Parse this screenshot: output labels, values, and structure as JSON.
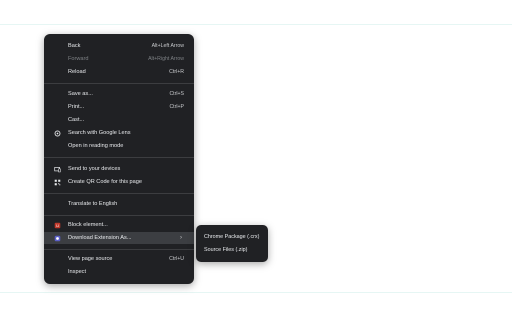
{
  "context_menu": {
    "items": {
      "back": {
        "label": "Back",
        "shortcut": "Alt+Left Arrow"
      },
      "forward": {
        "label": "Forward",
        "shortcut": "Alt+Right Arrow"
      },
      "reload": {
        "label": "Reload",
        "shortcut": "Ctrl+R"
      },
      "save_as": {
        "label": "Save as...",
        "shortcut": "Ctrl+S"
      },
      "print": {
        "label": "Print...",
        "shortcut": "Ctrl+P"
      },
      "cast": {
        "label": "Cast..."
      },
      "search_lens": {
        "label": "Search with Google Lens",
        "icon": "google-lens-icon"
      },
      "reading_mode": {
        "label": "Open in reading mode"
      },
      "send_devices": {
        "label": "Send to your devices",
        "icon": "devices-icon"
      },
      "qr_code": {
        "label": "Create QR Code for this page",
        "icon": "qr-code-icon"
      },
      "translate": {
        "label": "Translate to English"
      },
      "block_element": {
        "label": "Block element...",
        "icon": "adblock-icon"
      },
      "download_extension": {
        "label": "Download Extension As...",
        "icon": "extension-icon"
      },
      "view_source": {
        "label": "View page source",
        "shortcut": "Ctrl+U"
      },
      "inspect": {
        "label": "Inspect"
      }
    }
  },
  "submenu": {
    "items": {
      "chrome_package": {
        "label": "Chrome Package (.crx)"
      },
      "source_files": {
        "label": "Source Files (.zip)"
      }
    }
  },
  "colors": {
    "menu_bg": "#202124",
    "text": "#e8eaed",
    "disabled_text": "#7d8084",
    "hover_bg": "#3c3e42"
  }
}
